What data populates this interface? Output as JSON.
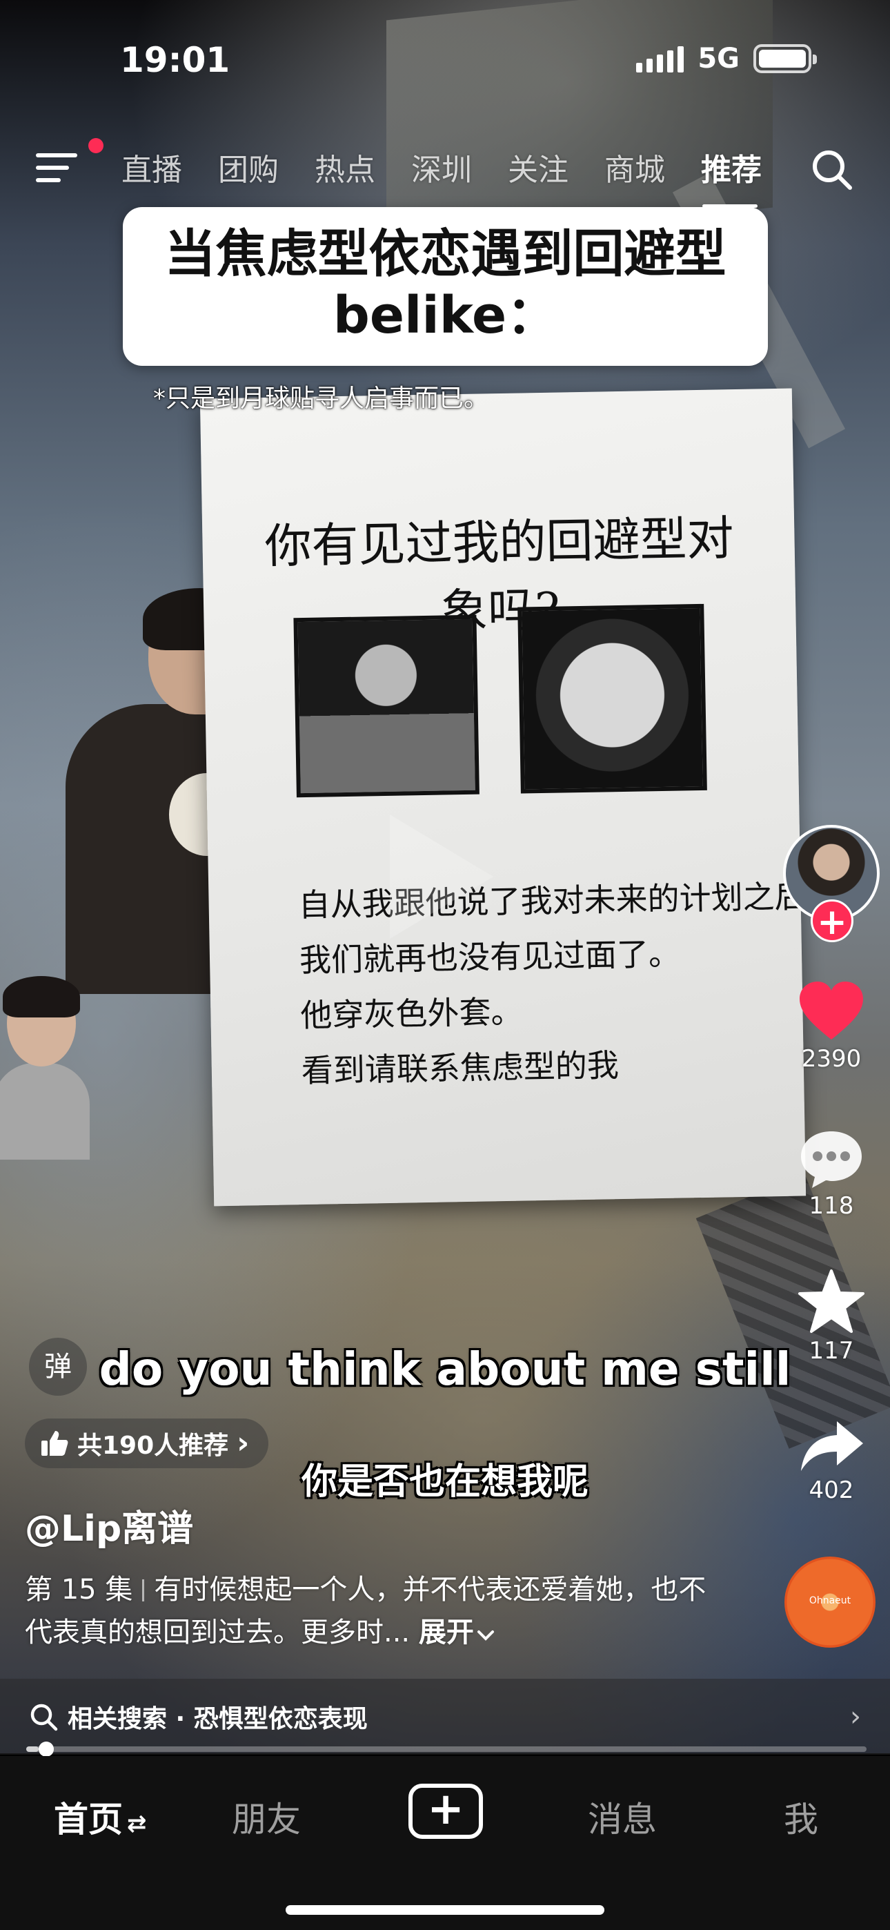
{
  "status_bar": {
    "time": "19:01",
    "network": "5G"
  },
  "top_nav": {
    "tabs": [
      "直播",
      "团购",
      "热点",
      "深圳",
      "关注",
      "商城",
      "推荐"
    ],
    "active_tab": "推荐"
  },
  "video": {
    "title_line1": "当焦虑型依恋遇到回避型",
    "title_line2": "belike：",
    "title_note": "*只是到月球贴寻人启事而已。",
    "poster_title": "你有见过我的回避型对象吗?",
    "poster_lines": [
      "自从我跟他说了我对未来的计划之后,",
      "我们就再也没有见过面了。",
      "他穿灰色外套。",
      "看到请联系焦虑型的我"
    ],
    "caption_en": "do you think about me still",
    "caption_zh": "你是否也在想我呢"
  },
  "rail": {
    "likes": "2390",
    "comments": "118",
    "favorites": "117",
    "shares": "402",
    "music_label": "Ohnaeut"
  },
  "danmu_label": "弹",
  "recommend": {
    "text": "共190人推荐",
    "chevron": "›"
  },
  "author": "@Lip离谱",
  "description": {
    "episode": "第 15 集",
    "text": "有时候想起一个人，并不代表还爱着她，也不代表真的想回到过去。更多时...",
    "expand": "展开"
  },
  "related_search": {
    "label": "相关搜索 · 恐惧型依恋表现",
    "chevron": "›"
  },
  "progress": {
    "fraction": 0.015
  },
  "tabbar": {
    "home": "首页",
    "home_swap": "⇄",
    "friends": "朋友",
    "create": "+",
    "messages": "消息",
    "me": "我"
  },
  "colors": {
    "accent": "#fe2c55",
    "like": "#fe2c55",
    "music_disc": "#ee6a2a"
  }
}
